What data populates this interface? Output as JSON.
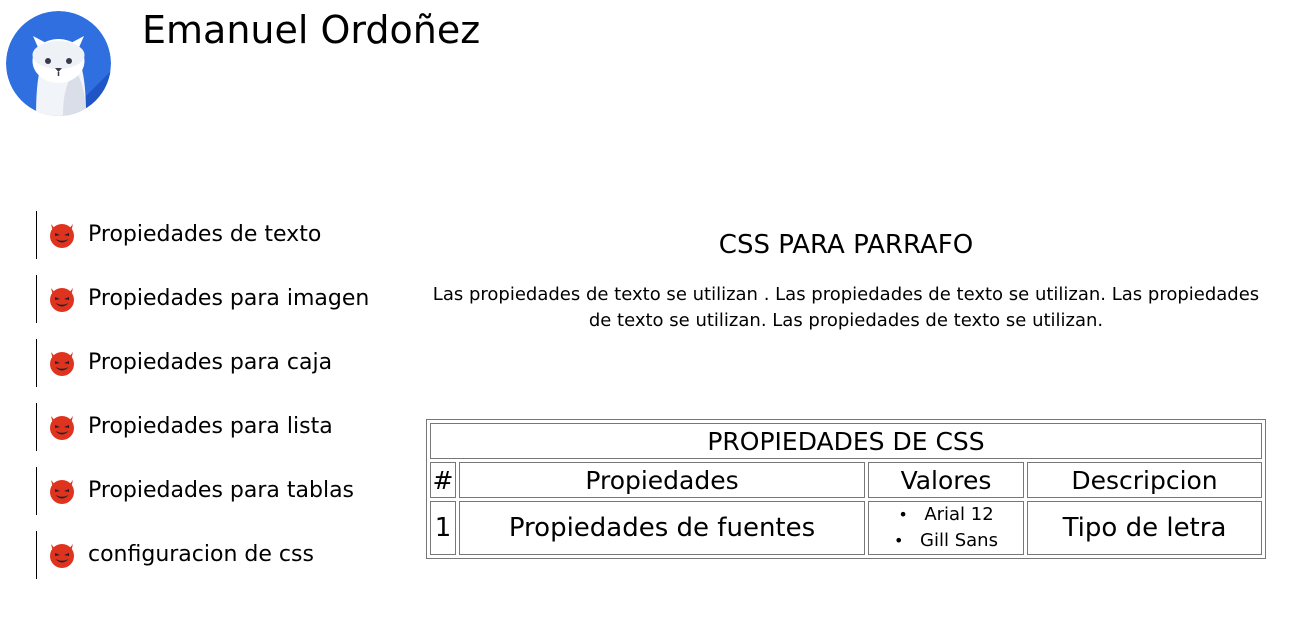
{
  "header": {
    "name": "Emanuel Ordoñez",
    "avatar_icon": "white-cat-avatar-icon"
  },
  "sidebar": {
    "icon": "smiling-devil-icon",
    "items": [
      {
        "label": "Propiedades de texto"
      },
      {
        "label": "Propiedades para imagen"
      },
      {
        "label": "Propiedades para caja"
      },
      {
        "label": "Propiedades para lista"
      },
      {
        "label": "Propiedades para tablas"
      },
      {
        "label": "configuracion de css"
      }
    ]
  },
  "main": {
    "title": "CSS PARA PARRAFO",
    "paragraph": "Las propiedades de texto se utilizan . Las propiedades de texto se utilizan. Las propiedades de texto se utilizan. Las propiedades de texto se utilizan."
  },
  "table": {
    "title": "PROPIEDADES DE CSS",
    "headers": [
      "#",
      "Propiedades",
      "Valores",
      "Descripcion"
    ],
    "rows": [
      {
        "num": "1",
        "property": "Propiedades de fuentes",
        "values": [
          "Arial 12",
          "Gill Sans"
        ],
        "description": "Tipo de letra"
      }
    ]
  },
  "colors": {
    "avatar_bg": "#2f6fe0",
    "devil_red": "#e0331f",
    "border": "#777777"
  }
}
